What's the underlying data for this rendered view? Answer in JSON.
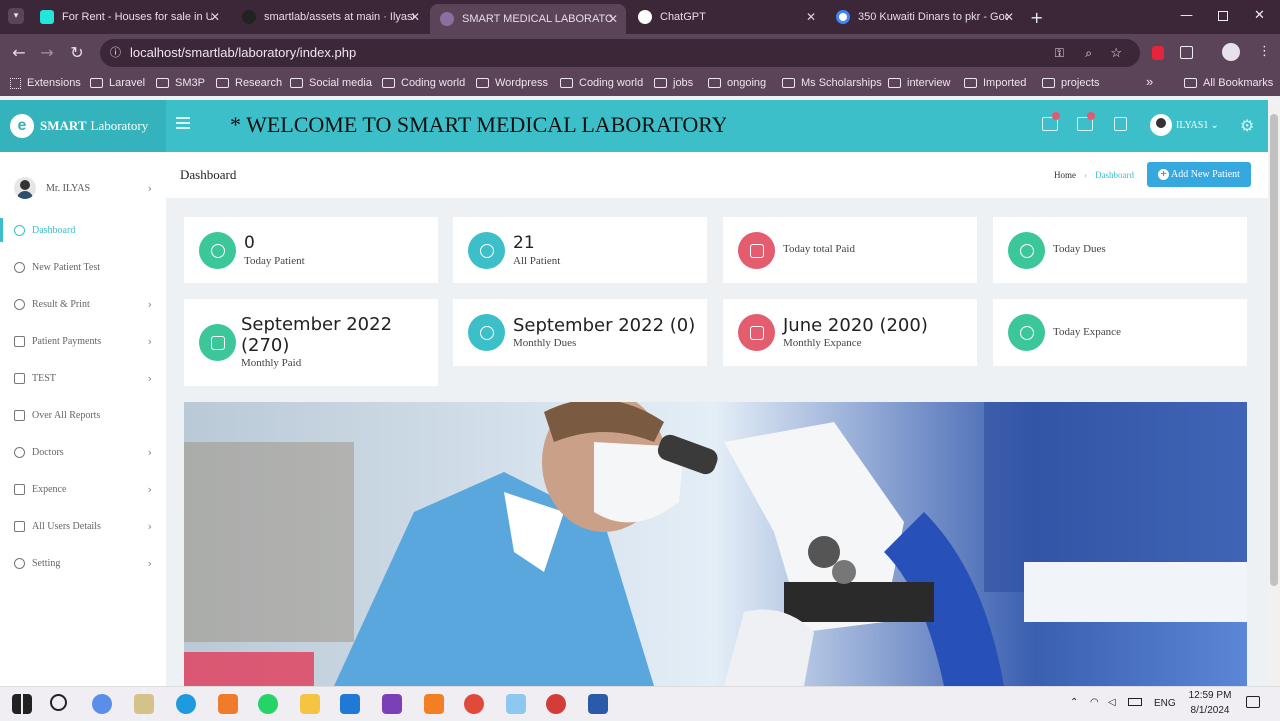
{
  "browser": {
    "tabs": [
      {
        "label": "For Rent - Houses for sale in Un",
        "color": "#23e5db"
      },
      {
        "label": "smartlab/assets at main · Ilyas0",
        "color": "#222222"
      },
      {
        "label": "SMART MEDICAL LABORATORY",
        "color": "#8a6fa0",
        "active": true
      },
      {
        "label": "ChatGPT",
        "color": "#ffffff"
      },
      {
        "label": "350 Kuwaiti Dinars to pkr - Goo",
        "color": "#ffffff"
      }
    ],
    "url": "localhost/smartlab/laboratory/index.php",
    "bookmarks": [
      "Extensions",
      "Laravel",
      "SM3P",
      "Research",
      "Social media",
      "Coding world",
      "Wordpress",
      "Coding world",
      "jobs",
      "ongoing",
      "Ms Scholarships",
      "interview",
      "Imported",
      "projects"
    ],
    "all_bookmarks": "All Bookmarks",
    "overflow": "»"
  },
  "app": {
    "logo_bold": "SMART",
    "logo_normal": "Laboratory",
    "logo_mark": "e",
    "marquee": "* WELCOME TO SMART MEDICAL LABORATORY",
    "user_name": "ILYAS1",
    "user_caret": "⌄",
    "settings_glyph": "⚙"
  },
  "sidebar": {
    "profile_name": "Mr. ILYAS",
    "items": [
      {
        "label": "Dashboard",
        "active": true,
        "chevron": false
      },
      {
        "label": "New Patient Test",
        "chevron": false
      },
      {
        "label": "Result & Print",
        "chevron": true
      },
      {
        "label": "Patient Payments",
        "chevron": true
      },
      {
        "label": "TEST",
        "chevron": true
      },
      {
        "label": "Over All Reports",
        "chevron": false
      },
      {
        "label": "Doctors",
        "chevron": true
      },
      {
        "label": "Expence",
        "chevron": true
      },
      {
        "label": "All Users Details",
        "chevron": true
      },
      {
        "label": "Setting",
        "chevron": true
      }
    ],
    "chevron_glyph": "›"
  },
  "page": {
    "title": "Dashboard",
    "breadcrumb_home": "Home",
    "breadcrumb_sep": "›",
    "breadcrumb_current": "Dashboard",
    "add_button": "Add New Patient",
    "add_plus": "+"
  },
  "cards": [
    {
      "value": "0",
      "label": "Today Patient",
      "color": "green"
    },
    {
      "value": "21",
      "label": "All Patient",
      "color": "teal"
    },
    {
      "value": "",
      "label": "Today total Paid",
      "color": "red"
    },
    {
      "value": "",
      "label": "Today Dues",
      "color": "green"
    },
    {
      "value": "September 2022 (270)",
      "value_line1": "September 2022",
      "value_line2": "(270)",
      "label": "Monthly Paid",
      "color": "green"
    },
    {
      "value": "September 2022 (0)",
      "label": "Monthly Dues",
      "color": "teal"
    },
    {
      "value": "June 2020 (200)",
      "label": "Monthly Expance",
      "color": "red"
    },
    {
      "value": "",
      "label": "Today Expance",
      "color": "green"
    }
  ],
  "taskbar": {
    "lang": "ENG",
    "time": "12:59 PM",
    "date": "8/1/2024"
  }
}
